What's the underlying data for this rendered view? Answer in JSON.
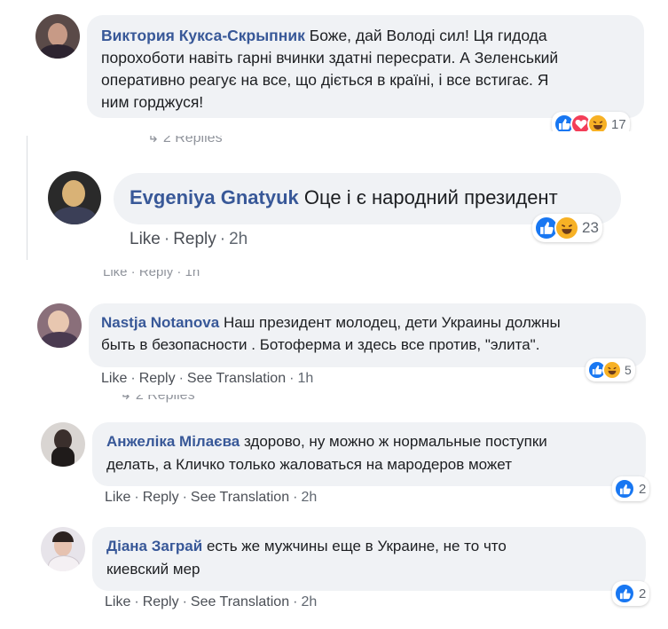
{
  "comments": [
    {
      "author": "Виктория Кукса-Скрыпник",
      "lines": [
        "Боже, дай Володі сил! Ця гидода",
        "порохоботи навіть гарні вчинки здатні пересрати. А Зеленський",
        "оперативно реагує на все, що діється в країні, і все встигає. Я",
        "ним горджуся!"
      ],
      "reaction_icons": [
        "like-icon",
        "love-icon",
        "haha-icon"
      ],
      "reaction_count": "17"
    },
    {
      "author": "Evgeniya Gnatyuk",
      "text": "Оце і є народний президент",
      "reaction_icons": [
        "like-icon",
        "haha-icon"
      ],
      "reaction_count": "23",
      "actions": {
        "like": "Like",
        "reply": "Reply",
        "time": "2h"
      }
    },
    {
      "author": "Nastja Notanova",
      "lines": [
        "Наш президент молодец, дети Украины должны",
        "быть в безопасности . Ботоферма и здесь все против, \"элита\"."
      ],
      "reaction_icons": [
        "like-icon",
        "haha-icon"
      ],
      "reaction_count": "5",
      "actions": {
        "like": "Like",
        "reply": "Reply",
        "translate": "See Translation",
        "time": "1h"
      }
    },
    {
      "author": "Анжеліка Мілаєва",
      "lines": [
        "здорово, ну можно ж нормальные поступки",
        "делать, а Кличко только жаловаться на мародеров может"
      ],
      "reaction_icons": [
        "like-icon"
      ],
      "reaction_count": "2",
      "actions": {
        "like": "Like",
        "reply": "Reply",
        "translate": "See Translation",
        "time": "2h"
      }
    },
    {
      "author": "Діана Заграй",
      "lines": [
        "есть же мужчины еще в Украине, не то что",
        "киевский мер"
      ],
      "reaction_icons": [
        "like-icon"
      ],
      "reaction_count": "2",
      "actions": {
        "like": "Like",
        "reply": "Reply",
        "translate": "See Translation",
        "time": "2h"
      }
    }
  ],
  "partial": {
    "replies_1": "2 Replies",
    "actions_line": "Like · Reply · 1h",
    "replies_2": "2 Replies"
  },
  "colors": {
    "link": "#385898",
    "bubble": "#f0f2f5",
    "like": "#1877f2",
    "love": "#f33e58",
    "haha": "#f7b125",
    "meta": "#606770"
  }
}
